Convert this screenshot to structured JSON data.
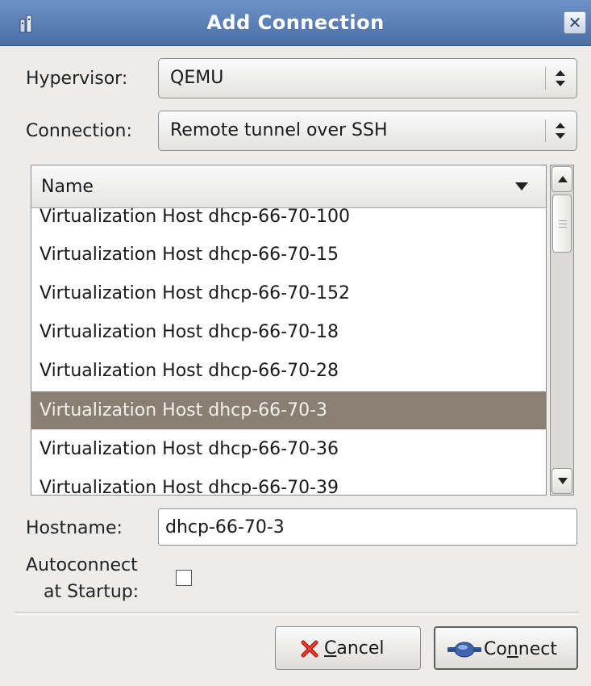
{
  "window": {
    "title": "Add Connection",
    "close_glyph": "✕"
  },
  "form": {
    "hypervisor_label": "Hypervisor:",
    "hypervisor_value": "QEMU",
    "connection_label": "Connection:",
    "connection_value": "Remote tunnel over SSH",
    "list_column_header": "Name",
    "hosts": [
      "Virtualization Host dhcp-66-70-100",
      "Virtualization Host dhcp-66-70-15",
      "Virtualization Host dhcp-66-70-152",
      "Virtualization Host dhcp-66-70-18",
      "Virtualization Host dhcp-66-70-28",
      "Virtualization Host dhcp-66-70-3",
      "Virtualization Host dhcp-66-70-36",
      "Virtualization Host dhcp-66-70-39"
    ],
    "selected_host": "Virtualization Host dhcp-66-70-3",
    "hostname_label": "Hostname:",
    "hostname_value": "dhcp-66-70-3",
    "autoconnect_label_line1": "Autoconnect",
    "autoconnect_label_line2": "at Startup:",
    "autoconnect_checked": false
  },
  "buttons": {
    "cancel_mnemonic": "C",
    "cancel_rest": "ancel",
    "connect_pre": "Co",
    "connect_mnemonic": "n",
    "connect_rest": "nect"
  },
  "colors": {
    "titlebar": "#5a7db3",
    "selection": "#8a7f73",
    "dialog_bg": "#edeceb"
  },
  "icons": {
    "title": "window-app-icon",
    "cancel": "red-x-icon",
    "connect": "plug-connector-icon"
  }
}
